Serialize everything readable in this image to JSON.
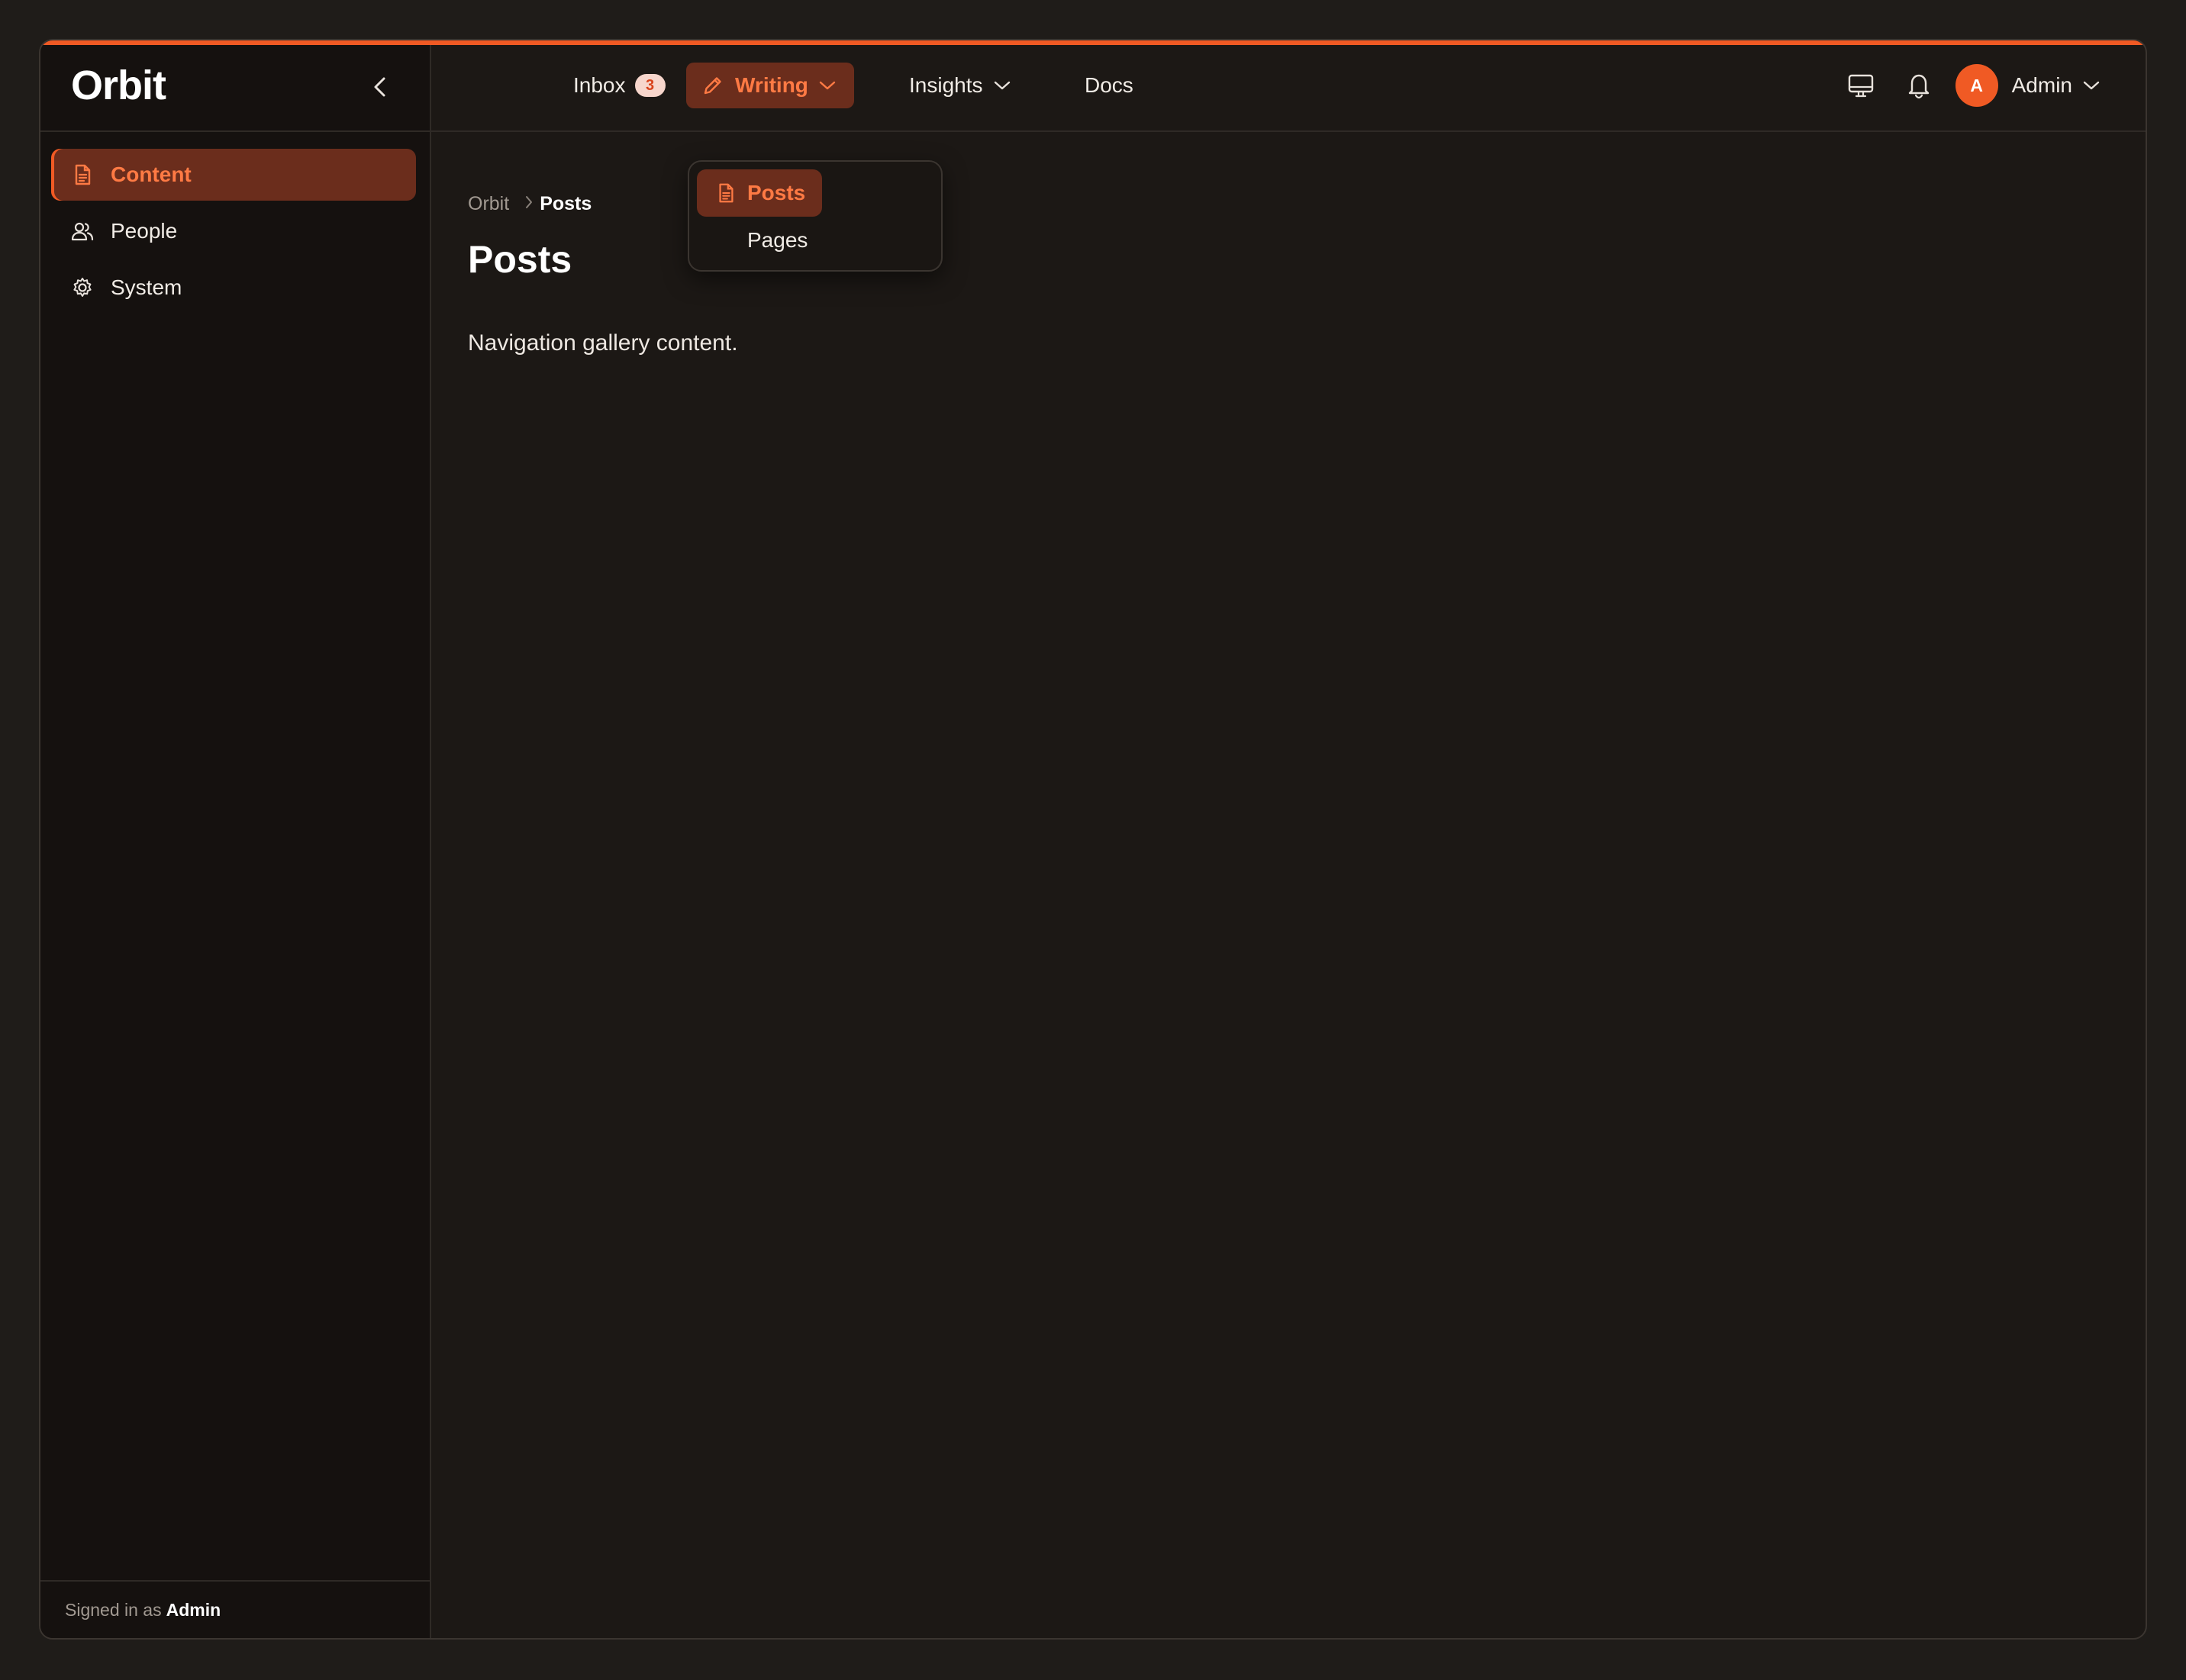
{
  "app": {
    "name": "Orbit",
    "accent_color": "#f05a24"
  },
  "sidebar": {
    "collapse_icon": "chevron-left-icon",
    "items": [
      {
        "label": "Content",
        "icon": "file-text-icon",
        "active": true
      },
      {
        "label": "People",
        "icon": "users-icon",
        "active": false
      },
      {
        "label": "System",
        "icon": "gear-icon",
        "active": false
      }
    ],
    "footer": {
      "prefix": "Signed in as",
      "user": "Admin"
    }
  },
  "topnav": {
    "inbox": {
      "label": "Inbox",
      "badge": "3"
    },
    "writing": {
      "label": "Writing",
      "icon": "pencil-icon",
      "expanded": true
    },
    "insights": {
      "label": "Insights"
    },
    "docs": {
      "label": "Docs"
    }
  },
  "writing_menu": {
    "items": [
      {
        "label": "Posts",
        "icon": "file-text-icon",
        "active": true
      },
      {
        "label": "Pages",
        "active": false
      }
    ]
  },
  "toolbar": {
    "display_icon": "monitor-icon",
    "notification_icon": "bell-icon"
  },
  "user": {
    "initial": "A",
    "name": "Admin"
  },
  "main": {
    "breadcrumb": [
      "Orbit",
      "Posts"
    ],
    "title": "Posts",
    "body": "Navigation gallery content."
  }
}
